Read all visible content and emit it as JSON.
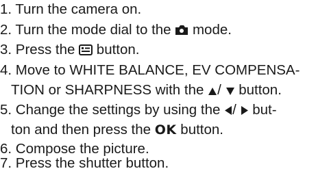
{
  "steps": {
    "s1": "1. Turn the camera on.",
    "s2a": "2. Turn the mode dial to the",
    "s2b": "mode.",
    "s3a": "3. Press the",
    "s3b": "button.",
    "s4a": "4. Move to WHITE BALANCE, EV COMPENSA-",
    "s4b": "TION or SHARPNESS with the",
    "s4c": "/",
    "s4d": "button.",
    "s5a": "5. Change the settings by using the",
    "s5b": "/",
    "s5c": "but-",
    "s5d": "ton and then press the",
    "s5e": "OK",
    "s5f": "button.",
    "s6": "6. Compose the picture.",
    "s7": "7. Press the shutter button."
  },
  "icons": {
    "mode": "camera-mode-icon",
    "menu": "menu-button-icon",
    "up": "up-arrow-icon",
    "down": "down-arrow-icon",
    "left": "left-arrow-icon",
    "right": "right-arrow-icon"
  },
  "colors": {
    "text": "#1a1a1a",
    "background": "#ffffff"
  }
}
